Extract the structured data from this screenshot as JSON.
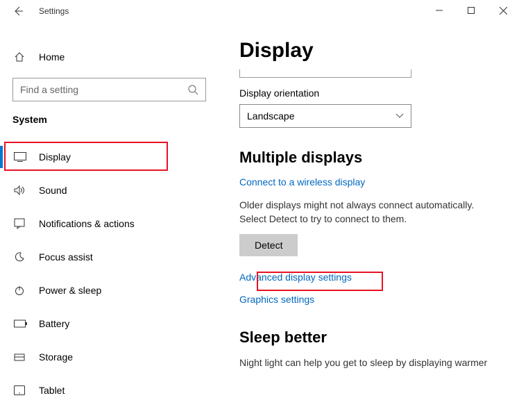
{
  "window": {
    "title": "Settings"
  },
  "sidebar": {
    "home_label": "Home",
    "search_placeholder": "Find a setting",
    "section_label": "System",
    "items": [
      {
        "label": "Display"
      },
      {
        "label": "Sound"
      },
      {
        "label": "Notifications & actions"
      },
      {
        "label": "Focus assist"
      },
      {
        "label": "Power & sleep"
      },
      {
        "label": "Battery"
      },
      {
        "label": "Storage"
      },
      {
        "label": "Tablet"
      }
    ]
  },
  "main": {
    "page_title": "Display",
    "orientation_label": "Display orientation",
    "orientation_value": "Landscape",
    "multiple_displays_heading": "Multiple displays",
    "wireless_link": "Connect to a wireless display",
    "detect_text": "Older displays might not always connect automatically. Select Detect to try to connect to them.",
    "detect_button": "Detect",
    "advanced_link": "Advanced display settings",
    "graphics_link": "Graphics settings",
    "sleep_heading": "Sleep better",
    "sleep_text": "Night light can help you get to sleep by displaying warmer"
  }
}
